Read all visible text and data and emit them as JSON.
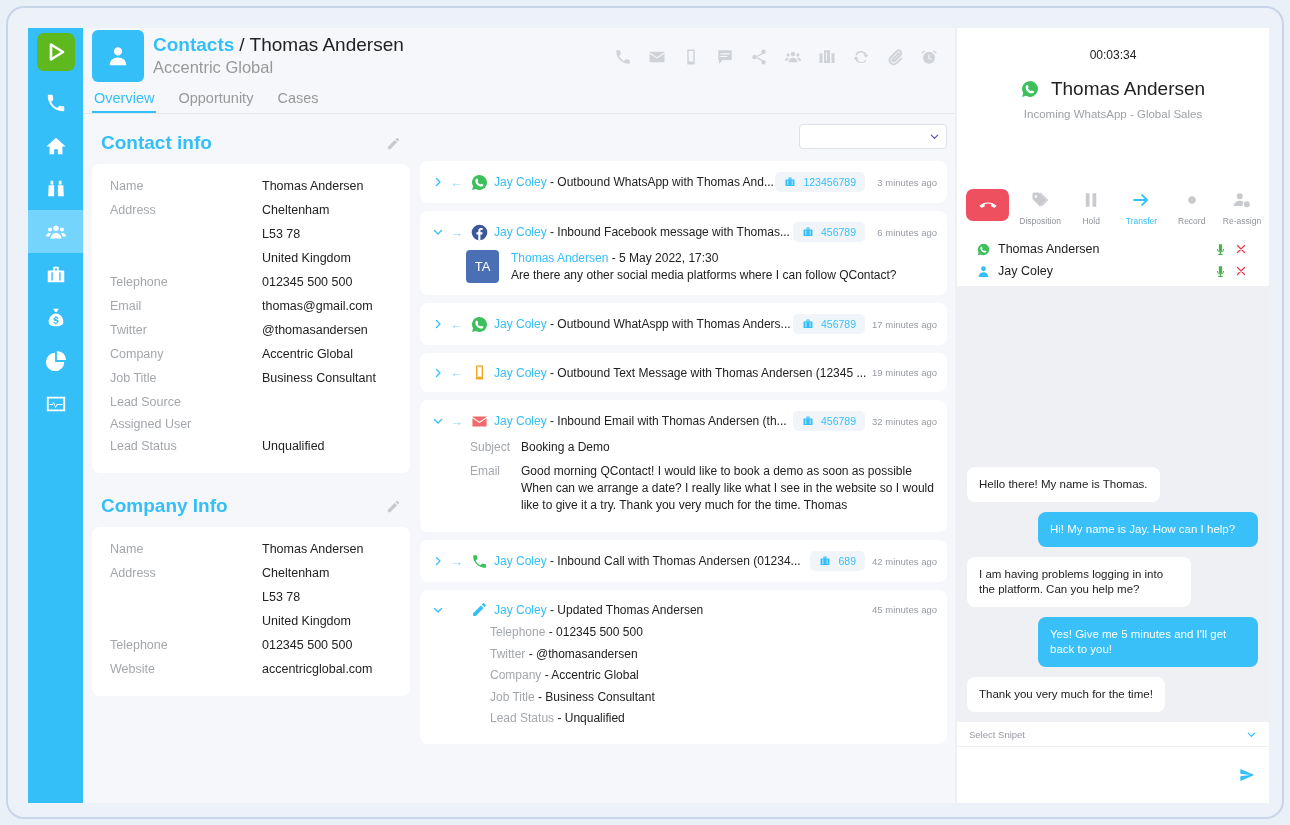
{
  "sidebar": {
    "items": [
      {
        "kind": "phone",
        "selected": false
      },
      {
        "kind": "home",
        "selected": false
      },
      {
        "kind": "binoculars",
        "selected": false
      },
      {
        "kind": "users",
        "selected": true
      },
      {
        "kind": "briefcase",
        "selected": false
      },
      {
        "kind": "money-bag",
        "selected": false
      },
      {
        "kind": "pie-chart",
        "selected": false
      },
      {
        "kind": "monitor",
        "selected": false
      }
    ]
  },
  "header": {
    "section": "Contacts",
    "separator": "/",
    "title": "Thomas Andersen",
    "subtitle": "Accentric Global"
  },
  "tabs": [
    {
      "label": "Overview",
      "selected": true
    },
    {
      "label": "Opportunity",
      "selected": false
    },
    {
      "label": "Cases",
      "selected": false
    }
  ],
  "panels": [
    {
      "title": "Contact info",
      "fields": [
        {
          "label": "Name",
          "values": [
            "Thomas Andersen"
          ]
        },
        {
          "label": "Address",
          "values": [
            "Cheltenham",
            "L53 78",
            "United Kingdom"
          ]
        },
        {
          "label": "Telephone",
          "values": [
            "012345 500 500"
          ]
        },
        {
          "label": "Email",
          "values": [
            "thomas@gmail.com"
          ]
        },
        {
          "label": "Twitter",
          "values": [
            "@thomasandersen"
          ]
        },
        {
          "label": "Company",
          "values": [
            "Accentric Global"
          ]
        },
        {
          "label": "Job Title",
          "values": [
            "Business Consultant"
          ]
        },
        {
          "label": "Lead Source"
        },
        {
          "label": "Assigned User"
        },
        {
          "label": "Lead Status",
          "values": [
            "Unqualified"
          ]
        }
      ]
    },
    {
      "title": "Company Info",
      "fields": [
        {
          "label": "Name",
          "values": [
            "Thomas Andersen"
          ]
        },
        {
          "label": "Address",
          "values": [
            "Cheltenham",
            "L53 78",
            "United Kingdom"
          ]
        },
        {
          "label": "Telephone",
          "values": [
            "012345 500 500"
          ]
        },
        {
          "label": "Website",
          "values": [
            "accentricglobal.com"
          ]
        }
      ]
    }
  ],
  "activities": [
    {
      "kind": "whatsapp",
      "expanded": false,
      "direction": "←",
      "agent": "Jay Coley",
      "summary": "- Outbound WhatsApp with Thomas And...",
      "case": "123456789",
      "time": "3 minutes ago"
    },
    {
      "kind": "facebook",
      "expanded": true,
      "direction": "→",
      "agent": "Jay Coley",
      "summary": "- Inbound Facebook message with Thomas...",
      "case": "456789",
      "time": "6 minutes ago",
      "message": {
        "initials": "TA",
        "author": "Thomas Andersen",
        "date": "- 5 May 2022, 17:30",
        "text": "Are there any other social media platforms where I can follow QContact?"
      }
    },
    {
      "kind": "whatsapp",
      "expanded": false,
      "direction": "←",
      "agent": "Jay Coley",
      "summary": "- Outbound WhatAspp with Thomas Anders...",
      "case": "456789",
      "time": "17 minutes ago"
    },
    {
      "kind": "sms",
      "expanded": false,
      "direction": "←",
      "agent": "Jay Coley",
      "summary": "- Outbound Text Message with Thomas Andersen (12345 ...",
      "time": "19 minutes ago"
    },
    {
      "kind": "email",
      "expanded": true,
      "direction": "→",
      "agent": "Jay Coley",
      "summary": "- Inbound Email with Thomas Andersen (th...",
      "case": "456789",
      "time": "32 minutes ago",
      "fields": [
        {
          "label": "Subject",
          "value": "Booking a Demo"
        },
        {
          "label": "Email",
          "value": "Good morning QContact! I would like to book a demo as soon as possible When can we arrange a date? I really like what I see in the website so I would like to give it a try. Thank you very much for the time. Thomas"
        }
      ]
    },
    {
      "kind": "call",
      "expanded": false,
      "direction": "→",
      "agent": "Jay Coley",
      "summary": "- Inbound Call with Thomas Andersen (01234...",
      "case": "689",
      "time": "42 minutes ago"
    },
    {
      "kind": "update",
      "expanded": true,
      "agent": "Jay Coley",
      "summary": "- Updated Thomas Andersen",
      "time": "45 minutes ago",
      "changes": [
        {
          "label": "Telephone",
          "value": "- 012345 500 500"
        },
        {
          "label": "Twitter",
          "value": "- @thomasandersen"
        },
        {
          "label": "Company",
          "value": "- Accentric Global"
        },
        {
          "label": "Job Title",
          "value": "- Business Consultant"
        },
        {
          "label": "Lead Status",
          "value": "- Unqualified"
        }
      ]
    }
  ],
  "call": {
    "timer": "00:03:34",
    "caller": "Thomas Andersen",
    "channel": "Incoming WhatsApp - Global Sales",
    "controls": [
      {
        "kind": "tag",
        "label": "Disposition",
        "selected": false
      },
      {
        "kind": "pause",
        "label": "Hold",
        "selected": false
      },
      {
        "kind": "arrow",
        "label": "Transfer",
        "selected": true
      },
      {
        "kind": "record",
        "label": "Record",
        "selected": false
      },
      {
        "kind": "reassign",
        "label": "Re-assign",
        "selected": false
      }
    ],
    "participants": [
      {
        "kind": "whatsapp",
        "name": "Thomas Andersen"
      },
      {
        "kind": "agent",
        "name": "Jay Coley"
      }
    ]
  },
  "chat": {
    "messages": [
      {
        "kind": "incoming",
        "text": "Hello there! My name is Thomas."
      },
      {
        "kind": "outgoing",
        "text": "Hi! My name is Jay. How can I help?"
      },
      {
        "kind": "incoming",
        "text": "I am having problems logging in into the platform. Can you help me?"
      },
      {
        "kind": "outgoing",
        "text": "Yes! Give me 5 minutes and I'll get back to you!"
      },
      {
        "kind": "incoming",
        "text": "Thank you very much for the time!"
      }
    ],
    "snippet": {
      "placeholder": "Select Snipet"
    }
  }
}
